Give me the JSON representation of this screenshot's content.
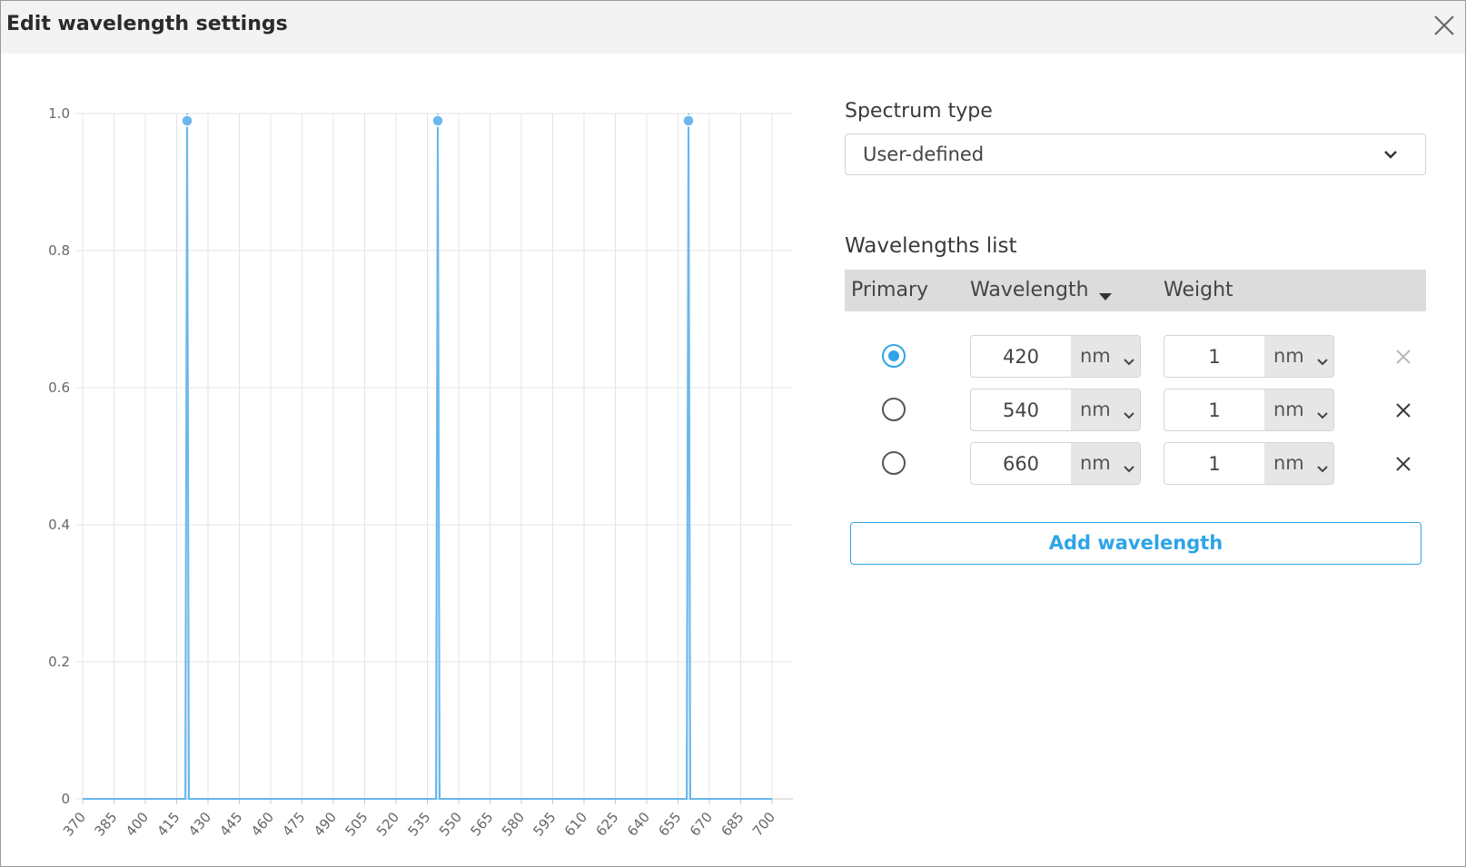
{
  "dialog": {
    "title": "Edit wavelength settings",
    "close_icon": "close-icon"
  },
  "spectrum": {
    "label": "Spectrum type",
    "value": "User-defined",
    "icon": "chevron-down-icon"
  },
  "wavelengths": {
    "label": "Wavelengths list",
    "columns": {
      "primary": "Primary",
      "wavelength": "Wavelength",
      "weight": "Weight"
    },
    "sort_icon": "sort-desc-icon",
    "rows": [
      {
        "primary": true,
        "wavelength": "420",
        "wavelength_unit": "nm",
        "weight": "1",
        "weight_unit": "nm"
      },
      {
        "primary": false,
        "wavelength": "540",
        "wavelength_unit": "nm",
        "weight": "1",
        "weight_unit": "nm"
      },
      {
        "primary": false,
        "wavelength": "660",
        "wavelength_unit": "nm",
        "weight": "1",
        "weight_unit": "nm"
      }
    ],
    "remove_icon": "close-icon"
  },
  "add_button": {
    "label": "Add wavelength"
  },
  "colors": {
    "accent": "#2fa4e7",
    "line": "#6ab7ec",
    "grid": "#e4e4e4"
  },
  "chart_data": {
    "type": "line",
    "x": [
      370,
      385,
      400,
      415,
      420,
      430,
      445,
      460,
      475,
      490,
      505,
      520,
      535,
      540,
      550,
      565,
      580,
      595,
      610,
      625,
      640,
      655,
      660,
      670,
      685,
      700
    ],
    "series": [
      {
        "values": [
          0,
          0,
          0,
          0,
          1,
          0,
          0,
          0,
          0,
          0,
          0,
          0,
          0,
          1,
          0,
          0,
          0,
          0,
          0,
          0,
          0,
          0,
          1,
          0,
          0,
          0
        ]
      }
    ],
    "x_ticks": [
      "370",
      "385",
      "400",
      "415",
      "430",
      "445",
      "460",
      "475",
      "490",
      "505",
      "520",
      "535",
      "550",
      "565",
      "580",
      "595",
      "610",
      "625",
      "640",
      "655",
      "670",
      "685",
      "700"
    ],
    "y_ticks": [
      "0",
      "0.2",
      "0.4",
      "0.6",
      "0.8",
      "1.0"
    ],
    "xlim": [
      370,
      710
    ],
    "ylim": [
      0,
      1
    ],
    "grid": true,
    "legend": "none"
  }
}
